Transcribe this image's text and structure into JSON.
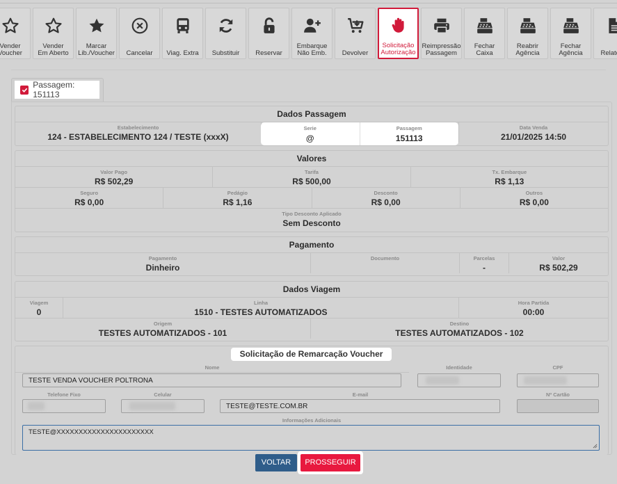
{
  "toolbar": [
    {
      "label": "Vender\nVoucher",
      "icon": "star-outline-icon"
    },
    {
      "label": "Vender\nEm Aberto",
      "icon": "star-outline-icon"
    },
    {
      "label": "Marcar\nLib./Voucher",
      "icon": "star-filled-icon"
    },
    {
      "label": "Cancelar",
      "icon": "cancel-circle-icon"
    },
    {
      "label": "Viag. Extra",
      "icon": "bus-icon"
    },
    {
      "label": "Substituir",
      "icon": "sync-icon"
    },
    {
      "label": "Reservar",
      "icon": "unlock-icon"
    },
    {
      "label": "Embarque\nNão Emb.",
      "icon": "user-plus-icon"
    },
    {
      "label": "Devolver",
      "icon": "cart-return-icon"
    },
    {
      "label": "Solicitação\nAutorização",
      "icon": "hand-stop-icon"
    },
    {
      "label": "Reimpressão\nPassagem",
      "icon": "printer-icon"
    },
    {
      "label": "Fechar\nCaixa",
      "icon": "cash-register-icon"
    },
    {
      "label": "Reabrir\nAgência",
      "icon": "cash-register-icon"
    },
    {
      "label": "Fechar\nAgência",
      "icon": "cash-register-icon"
    },
    {
      "label": "Relatório",
      "icon": "document-icon"
    }
  ],
  "colors": {
    "accent": "#d11a3a",
    "primary_button": "#2f5d8a",
    "proceed_button": "#e8193f"
  },
  "tab": {
    "label": "Passagem: 151113"
  },
  "dados_passagem": {
    "title": "Dados Passagem",
    "estabelecimento_label": "Estabelecimento",
    "estabelecimento": "124 - ESTABELECIMENTO 124 / TESTE (xxxX)",
    "serie_label": "Serie",
    "serie": "@",
    "passagem_label": "Passagem",
    "passagem": "151113",
    "data_venda_label": "Data Venda",
    "data_venda": "21/01/2025 14:50"
  },
  "valores": {
    "title": "Valores",
    "valor_pago_label": "Valor Pago",
    "valor_pago": "R$ 502,29",
    "tarifa_label": "Tarifa",
    "tarifa": "R$ 500,00",
    "tx_embarque_label": "Tx. Embarque",
    "tx_embarque": "R$ 1,13",
    "seguro_label": "Seguro",
    "seguro": "R$ 0,00",
    "pedagio_label": "Pedágio",
    "pedagio": "R$ 1,16",
    "desconto_label": "Desconto",
    "desconto": "R$ 0,00",
    "outros_label": "Outros",
    "outros": "R$ 0,00",
    "tipo_desconto_label": "Tipo Desconto Aplicado",
    "tipo_desconto": "Sem Desconto"
  },
  "pagamento": {
    "title": "Pagamento",
    "pagamento_label": "Pagamento",
    "pagamento": "Dinheiro",
    "documento_label": "Documento",
    "documento": "",
    "parcelas_label": "Parcelas",
    "parcelas": "-",
    "valor_label": "Valor",
    "valor": "R$ 502,29"
  },
  "dados_viagem": {
    "title": "Dados Viagem",
    "viagem_label": "Viagem",
    "viagem": "0",
    "linha_label": "Linha",
    "linha": "1510 - TESTES AUTOMATIZADOS",
    "hora_partida_label": "Hora Partida",
    "hora_partida": "00:00",
    "origem_label": "Origem",
    "origem": "TESTES AUTOMATIZADOS - 101",
    "destino_label": "Destino",
    "destino": "TESTES AUTOMATIZADOS - 102"
  },
  "form": {
    "title": "Solicitação de Remarcação Voucher",
    "nome_label": "Nome",
    "nome": "TESTE VENDA VOUCHER POLTRONA",
    "identidade_label": "Identidade",
    "cpf_label": "CPF",
    "telefone_label": "Telefone Fixo",
    "celular_label": "Celular",
    "email_label": "E-mail",
    "email": "TESTE@TESTE.COM.BR",
    "cartao_label": "Nº Cartão",
    "info_label": "Informações Adicionais",
    "info": "TESTE@XXXXXXXXXXXXXXXXXXXXXX"
  },
  "buttons": {
    "voltar": "VOLTAR",
    "prosseguir": "PROSSEGUIR"
  }
}
